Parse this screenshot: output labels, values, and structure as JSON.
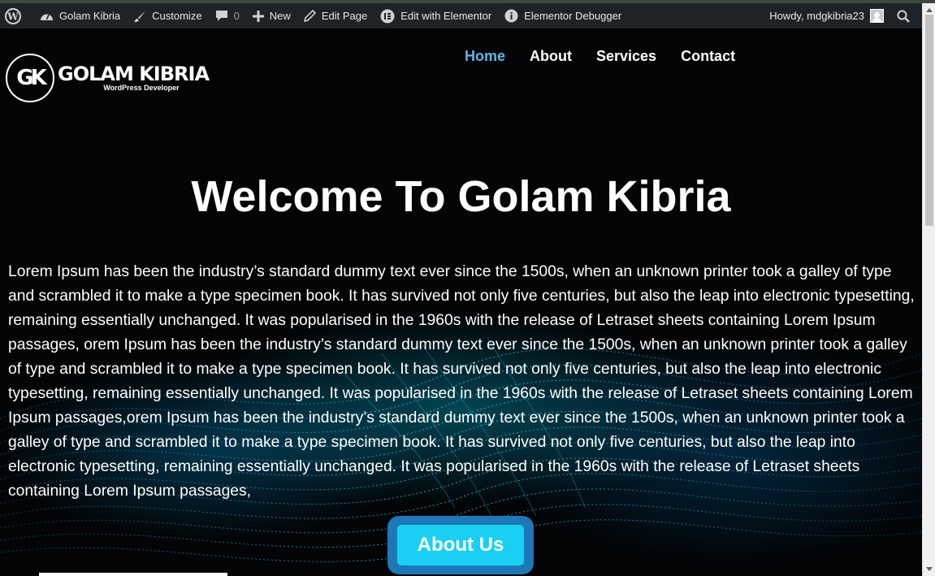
{
  "admin_bar": {
    "site_name": "Golam Kibria",
    "customize": "Customize",
    "comments_count": "0",
    "new": "New",
    "edit_page": "Edit Page",
    "edit_elementor": "Edit with Elementor",
    "debugger": "Elementor Debugger",
    "howdy": "Howdy, mdgkibria23"
  },
  "logo": {
    "monogram": "GK",
    "title": "GOLAM KIBRIA",
    "subtitle": "WordPress Developer"
  },
  "nav": {
    "items": [
      "Home",
      "About",
      "Services",
      "Contact"
    ],
    "active": "Home"
  },
  "hero": {
    "title": "Welcome To Golam Kibria",
    "body": "Lorem Ipsum has been the industry’s standard dummy text ever since the 1500s, when an unknown printer took a galley of type and scrambled it to make a type specimen book. It has survived not only five centuries, but also the leap into electronic typesetting, remaining essentially unchanged. It was popularised in the 1960s with the release of Letraset sheets containing Lorem Ipsum passages, orem Ipsum has been the industry’s standard dummy text ever since the 1500s, when an unknown printer took a galley of type and scrambled it to make a type specimen book. It has survived not only five centuries, but also the leap into electronic typesetting, remaining essentially unchanged. It was popularised in the 1960s with the release of Letraset sheets containing Lorem Ipsum passages,orem Ipsum has been the industry’s standard dummy text ever since the 1500s, when an unknown printer took a galley of type and scrambled it to make a type specimen book. It has survived not only five centuries, but also the leap into electronic typesetting, remaining essentially unchanged. It was popularised in the 1960s with the release of Letraset sheets containing Lorem Ipsum passages,",
    "button": "About Us"
  },
  "colors": {
    "admin_bar_bg": "#1d2327",
    "nav_active": "#5fb3e8",
    "button_bg": "#1ad0f2",
    "button_frame": "#1e78b8"
  }
}
